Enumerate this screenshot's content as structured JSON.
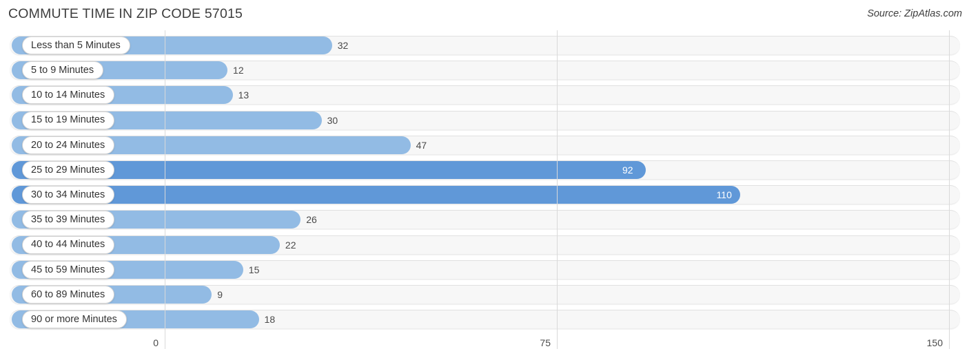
{
  "header": {
    "title": "COMMUTE TIME IN ZIP CODE 57015",
    "source": "Source: ZipAtlas.com"
  },
  "colors": {
    "bar_light": "#92bbe4",
    "bar_dark": "#6098d8",
    "track": "#f7f7f7",
    "gridline": "#d9d9d9",
    "text": "#3d3d3d"
  },
  "chart_data": {
    "type": "bar",
    "orientation": "horizontal",
    "title": "COMMUTE TIME IN ZIP CODE 57015",
    "xlabel": "",
    "ylabel": "",
    "xlim": [
      0,
      150
    ],
    "xticks": [
      0,
      75,
      150
    ],
    "xtick_labels": [
      "0",
      "75",
      "150"
    ],
    "grid": true,
    "legend": null,
    "categories": [
      "Less than 5 Minutes",
      "5 to 9 Minutes",
      "10 to 14 Minutes",
      "15 to 19 Minutes",
      "20 to 24 Minutes",
      "25 to 29 Minutes",
      "30 to 34 Minutes",
      "35 to 39 Minutes",
      "40 to 44 Minutes",
      "45 to 59 Minutes",
      "60 to 89 Minutes",
      "90 or more Minutes"
    ],
    "values": [
      32,
      12,
      13,
      30,
      47,
      92,
      110,
      26,
      22,
      15,
      9,
      18
    ],
    "value_labels": [
      "32",
      "12",
      "13",
      "30",
      "47",
      "92",
      "110",
      "26",
      "22",
      "15",
      "9",
      "18"
    ],
    "highlighted": [
      false,
      false,
      false,
      false,
      false,
      true,
      true,
      false,
      false,
      false,
      false,
      false
    ]
  }
}
